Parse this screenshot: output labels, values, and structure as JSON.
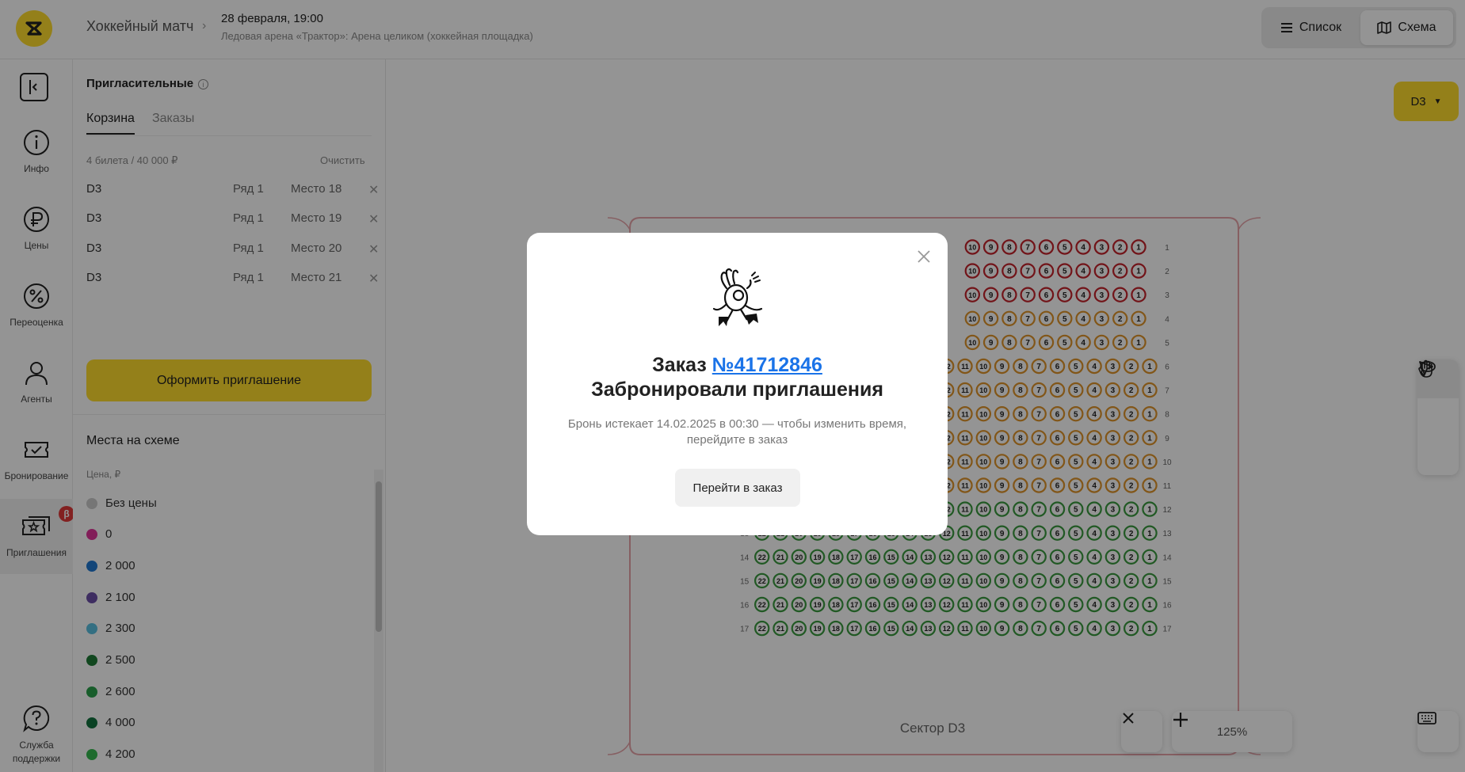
{
  "header": {
    "event_title": "Хоккейный матч",
    "event_date": "28 февраля, 19:00",
    "event_venue": "Ледовая арена «Трактор»: Арена целиком (хоккейная площадка)",
    "view_list_label": "Список",
    "view_scheme_label": "Схема",
    "active_view": "Схема"
  },
  "rail": {
    "items": [
      {
        "label": "Инфо",
        "icon": "info-icon"
      },
      {
        "label": "Цены",
        "icon": "ruble-icon"
      },
      {
        "label": "Переоценка",
        "icon": "percent-icon"
      },
      {
        "label": "Агенты",
        "icon": "user-icon"
      },
      {
        "label": "Бронирование",
        "icon": "ticket-check-icon"
      },
      {
        "label": "Приглашения",
        "icon": "tickets-star-icon",
        "badge": "β"
      },
      {
        "label": "Служба поддержки",
        "icon": "help-icon"
      }
    ],
    "active": "Приглашения"
  },
  "panel": {
    "title": "Пригласительные",
    "tabs": [
      "Корзина",
      "Заказы"
    ],
    "active_tab": "Корзина",
    "cart_summary": "4 билета / 40 000 ₽",
    "clear_label": "Очистить",
    "tickets": [
      {
        "sector": "D3",
        "row": "Ряд 1",
        "seat": "Место 18"
      },
      {
        "sector": "D3",
        "row": "Ряд 1",
        "seat": "Место 19"
      },
      {
        "sector": "D3",
        "row": "Ряд 1",
        "seat": "Место 20"
      },
      {
        "sector": "D3",
        "row": "Ряд 1",
        "seat": "Место 21"
      }
    ],
    "cta_label": "Оформить приглашение",
    "legend_title": "Места на схеме",
    "legend_subtitle": "Цена, ₽",
    "legend": [
      {
        "label": "Без цены",
        "color": "#cccccc"
      },
      {
        "label": "0",
        "color": "#e0359a"
      },
      {
        "label": "2 000",
        "color": "#1f78d1"
      },
      {
        "label": "2 100",
        "color": "#6b4fa8"
      },
      {
        "label": "2 300",
        "color": "#5bc0e0"
      },
      {
        "label": "2 500",
        "color": "#1e7a36"
      },
      {
        "label": "2 600",
        "color": "#2aa04a"
      },
      {
        "label": "4 000",
        "color": "#12733f"
      },
      {
        "label": "4 200",
        "color": "#34b84e"
      }
    ]
  },
  "map": {
    "sector_selector": "D3",
    "sector_label": "Сектор D3",
    "zoom_level": "125%",
    "seat_colors": {
      "red": "#c4232b",
      "orange": "#e0952a",
      "green": "#3a9a3e"
    },
    "rows": [
      {
        "row": "1",
        "status": "red"
      },
      {
        "row": "2",
        "status": "red"
      },
      {
        "row": "3",
        "status": "red"
      },
      {
        "row": "4",
        "status": "orange"
      },
      {
        "row": "5",
        "status": "orange"
      },
      {
        "row": "6",
        "status": "orange"
      },
      {
        "row": "7",
        "status": "orange"
      },
      {
        "row": "8",
        "status": "orange"
      },
      {
        "row": "9",
        "status": "orange"
      },
      {
        "row": "10",
        "status": "orange"
      },
      {
        "row": "11",
        "status": "orange"
      },
      {
        "row": "12",
        "status": "green"
      },
      {
        "row": "13",
        "status": "green"
      },
      {
        "row": "14",
        "status": "green"
      },
      {
        "row": "15",
        "status": "green"
      },
      {
        "row": "16",
        "status": "green"
      },
      {
        "row": "17",
        "status": "green"
      }
    ]
  },
  "modal": {
    "order_prefix": "Заказ ",
    "order_number": "№41712846",
    "heading": "Забронировали приглашения",
    "text": "Бронь истекает 14.02.2025 в 00:30 — чтобы изменить время, перейдите в заказ",
    "button_label": "Перейти в заказ"
  }
}
